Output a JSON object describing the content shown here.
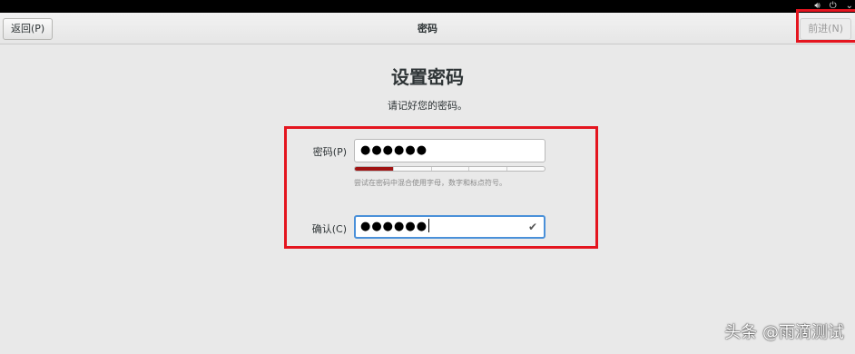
{
  "system_bar": {
    "icons": [
      "volume-icon",
      "power-icon",
      "chevron-down-icon"
    ]
  },
  "header": {
    "back_label": "返回(P)",
    "title": "密码",
    "next_label": "前进(N)"
  },
  "main": {
    "title": "设置密码",
    "subtitle": "请记好您的密码。",
    "password_label": "密码(P)",
    "password_value": "●●●●●●",
    "strength_level": 0.2,
    "hint": "尝试在密码中混合使用字母，数字和标点符号。",
    "confirm_label": "确认(C)",
    "confirm_value": "●●●●●●"
  },
  "watermark": "头条 @雨滴测试",
  "colors": {
    "highlight": "#e4151f",
    "strength_fill": "#a01414",
    "focus_border": "#4a90d9"
  }
}
